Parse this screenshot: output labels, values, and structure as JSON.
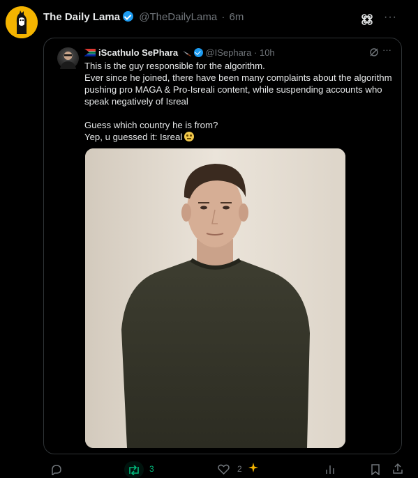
{
  "post": {
    "author_name": "The Daily Lama",
    "author_handle": "@TheDailyLama",
    "separator": "·",
    "time": "6m"
  },
  "quote": {
    "author_name": "iScathulo SePhara",
    "author_handle": "@ISephara",
    "separator": "·",
    "time": "10h",
    "lines": [
      "This is the guy responsible for the algorithm.",
      "Ever since he joined, there have been many complaints about the algorithm",
      "pushing pro MAGA & Pro-Isreali content, while suspending accounts who",
      "speak negatively of Isreal",
      "Guess which country he is from?",
      "Yep, u guessed it: Isreal"
    ]
  },
  "actions": {
    "reposts": "3",
    "likes": "2"
  },
  "colors": {
    "background": "#000000",
    "verified": "#1d9bf0",
    "repost_active": "#00ba7c",
    "muted": "#71767b"
  },
  "icons": [
    "grok-icon",
    "more-icon",
    "reply-icon",
    "repost-icon",
    "like-icon",
    "views-icon",
    "bookmark-icon",
    "share-icon"
  ]
}
